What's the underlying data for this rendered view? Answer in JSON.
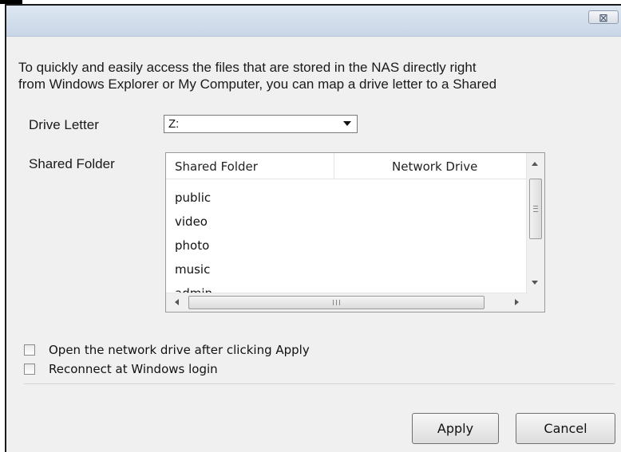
{
  "dialog": {
    "close_glyph": "⊠",
    "intro_line1": "To quickly and easily access the files that are stored in the NAS directly right",
    "intro_line2": "from Windows Explorer or My Computer, you can map a drive letter to a Shared",
    "drive_letter_label": "Drive Letter",
    "drive_letter_value": "Z:",
    "shared_folder_label": "Shared Folder",
    "list": {
      "columns": [
        "Shared Folder",
        "Network Drive"
      ],
      "rows": [
        "public",
        "video",
        "photo",
        "music",
        "admin"
      ]
    },
    "checkboxes": [
      {
        "label": "Open the network drive after clicking Apply",
        "checked": false
      },
      {
        "label": "Reconnect at Windows login",
        "checked": false
      }
    ],
    "apply_label": "Apply",
    "cancel_label": "Cancel"
  }
}
